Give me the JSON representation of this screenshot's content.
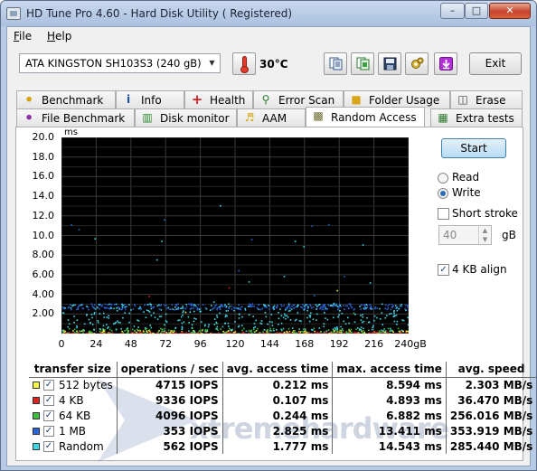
{
  "window": {
    "title": "HD Tune Pro 4.60 - Hard Disk Utility (  Registered)",
    "controls": {
      "minimize": "–",
      "maximize": "□",
      "close": "✕"
    }
  },
  "menu": {
    "file": "File",
    "file_key": "F",
    "file_rest": "ile",
    "help": "Help",
    "help_key": "H",
    "help_rest": "elp"
  },
  "toolbar": {
    "drive": "ATA     KINGSTON SH103S3 (240 gB)",
    "temperature": "30°C",
    "exit_label": "Exit",
    "icons": [
      "copy-text-icon",
      "copy-screenshot-icon",
      "save-icon",
      "options-icon",
      "download-icon"
    ]
  },
  "tabs_row1": [
    {
      "label": "Benchmark",
      "icon": "benchmark-icon"
    },
    {
      "label": "Info",
      "icon": "info-icon"
    },
    {
      "label": "Health",
      "icon": "health-icon"
    },
    {
      "label": "Error Scan",
      "icon": "error-scan-icon"
    },
    {
      "label": "Folder Usage",
      "icon": "folder-icon"
    },
    {
      "label": "Erase",
      "icon": "erase-icon"
    }
  ],
  "tabs_row2": [
    {
      "label": "File Benchmark",
      "icon": "file-benchmark-icon"
    },
    {
      "label": "Disk monitor",
      "icon": "disk-monitor-icon"
    },
    {
      "label": "AAM",
      "icon": "speaker-icon"
    },
    {
      "label": "Random Access",
      "icon": "random-access-icon",
      "active": true
    },
    {
      "label": "Extra tests",
      "icon": "extra-tests-icon"
    }
  ],
  "controls": {
    "start_label": "Start",
    "read_label": "Read",
    "write_label": "Write",
    "mode": "Write",
    "short_stroke_label": "Short stroke",
    "short_stroke_checked": false,
    "short_stroke_value": "40",
    "gb_label": "gB",
    "align_label": "4 KB align",
    "align_checked": true
  },
  "table": {
    "headers": [
      "transfer size",
      "operations / sec",
      "avg. access time",
      "max. access time",
      "avg. speed"
    ],
    "rows": [
      {
        "color": "#f5f542",
        "size": "512 bytes",
        "ops": "4715 IOPS",
        "avg": "0.212 ms",
        "max": "8.594 ms",
        "speed": "2.303 MB/s"
      },
      {
        "color": "#e02020",
        "size": "4 KB",
        "ops": "9336 IOPS",
        "avg": "0.107 ms",
        "max": "4.893 ms",
        "speed": "36.470 MB/s"
      },
      {
        "color": "#3fbf3f",
        "size": "64 KB",
        "ops": "4096 IOPS",
        "avg": "0.244 ms",
        "max": "6.882 ms",
        "speed": "256.016 MB/s"
      },
      {
        "color": "#2a62d6",
        "size": "1 MB",
        "ops": "353 IOPS",
        "avg": "2.825 ms",
        "max": "13.411 ms",
        "speed": "353.919 MB/s"
      },
      {
        "color": "#3fd7e6",
        "size": "Random",
        "ops": "562 IOPS",
        "avg": "1.777 ms",
        "max": "14.543 ms",
        "speed": "285.440 MB/s"
      }
    ]
  },
  "watermark": "xtremehardware",
  "chart_data": {
    "type": "scatter",
    "ylabel": "ms",
    "y_ticks": [
      "20.0",
      "18.0",
      "16.0",
      "14.0",
      "12.0",
      "10.0",
      "8.00",
      "6.00",
      "4.00",
      "2.00"
    ],
    "x_ticks": [
      "0",
      "24",
      "48",
      "72",
      "96",
      "120",
      "144",
      "168",
      "192",
      "216",
      "240gB"
    ],
    "xlim": [
      0,
      240
    ],
    "ylim": [
      0,
      20
    ],
    "grid": true,
    "series": [
      {
        "name": "512 bytes",
        "color": "#f5f542",
        "band": [
          0.05,
          0.4
        ],
        "max": 8.594,
        "count": 140
      },
      {
        "name": "4 KB",
        "color": "#e02020",
        "band": [
          0.03,
          0.2
        ],
        "max": 4.893,
        "count": 180
      },
      {
        "name": "64 KB",
        "color": "#3fbf3f",
        "band": [
          0.1,
          0.6
        ],
        "max": 6.882,
        "count": 140
      },
      {
        "name": "1 MB",
        "color": "#2a62d6",
        "band": [
          2.5,
          3.1
        ],
        "max": 13.411,
        "count": 300
      },
      {
        "name": "Random",
        "color": "#3fd7e6",
        "band": [
          0.3,
          3.1
        ],
        "max": 14.543,
        "count": 380
      }
    ]
  }
}
